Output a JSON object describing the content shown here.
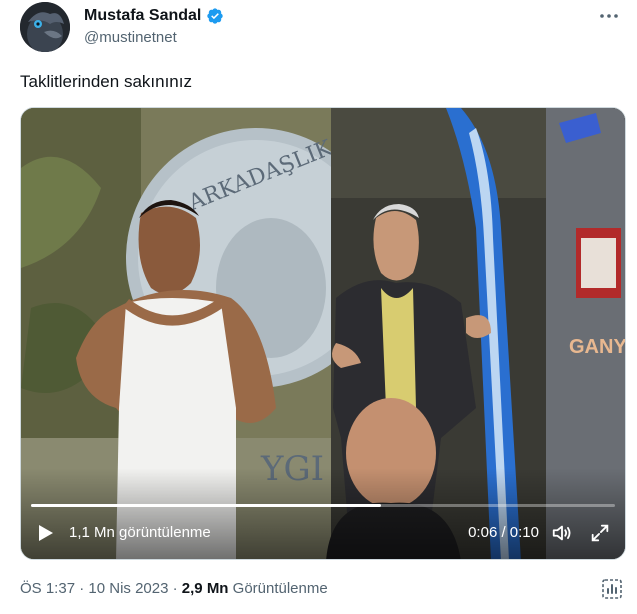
{
  "author": {
    "display_name": "Mustafa Sandal",
    "handle": "@mustinetnet"
  },
  "tweet": {
    "text": "Taklitlerinden sakınınız"
  },
  "video": {
    "views_label": "1,1 Mn görüntülenme",
    "time": "0:06 / 0:10",
    "progress": 0.6,
    "sign_left": "ARKADAŞLIK",
    "sign_left_bottom": "YGI S",
    "sign_right": "GANY"
  },
  "footer": {
    "time": "ÖS 1:37",
    "separator1": " · ",
    "date": "10 Nis 2023",
    "separator2": " · ",
    "views_count": "2,9 Mn",
    "views_label": " Görüntülenme"
  },
  "colors": {
    "verified": "#1d9bf0",
    "secondary_text": "#536471"
  }
}
